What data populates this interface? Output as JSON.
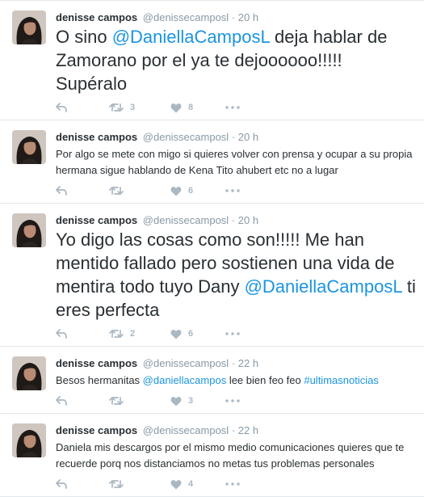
{
  "user": {
    "fullname": "denisse campos",
    "username": "@denissecamposl",
    "separator": "·"
  },
  "tweets": [
    {
      "time": "20 h",
      "size": "big",
      "segments": [
        {
          "t": "O sino ",
          "mention": false
        },
        {
          "t": "@DaniellaCamposL",
          "mention": true
        },
        {
          "t": " deja hablar de Zamorano por el ya te dejoooooo!!!!! Supéralo",
          "mention": false
        }
      ],
      "retweets": "3",
      "likes": "8"
    },
    {
      "time": "20 h",
      "size": "small",
      "segments": [
        {
          "t": "Por algo se mete con migo si quieres volver con prensa y ocupar a su propia hermana sigue hablando de Kena Tito ahubert etc no a lugar",
          "mention": false
        }
      ],
      "retweets": "",
      "likes": "6"
    },
    {
      "time": "20 h",
      "size": "big",
      "segments": [
        {
          "t": "Yo digo las cosas como son!!!!! Me han mentido fallado pero sostienen una vida de mentira todo tuyo Dany ",
          "mention": false
        },
        {
          "t": "@DaniellaCamposL",
          "mention": true
        },
        {
          "t": " ti eres perfecta",
          "mention": false
        }
      ],
      "retweets": "2",
      "likes": "6"
    },
    {
      "time": "22 h",
      "size": "small",
      "segments": [
        {
          "t": "Besos hermanitas ",
          "mention": false
        },
        {
          "t": "@daniellacampos",
          "mention": true
        },
        {
          "t": " lee bien feo feo ",
          "mention": false
        },
        {
          "t": "#ultimasnoticias",
          "mention": true
        }
      ],
      "retweets": "",
      "likes": "3"
    },
    {
      "time": "22 h",
      "size": "small",
      "segments": [
        {
          "t": "Daniela mis descargos por el mismo medio comunicaciones quieres que te recuerde porq nos distanciamos no metas tus problemas personales",
          "mention": false
        }
      ],
      "retweets": "",
      "likes": "4"
    }
  ],
  "icons": {
    "reply": "reply-icon",
    "retweet": "retweet-icon",
    "like": "heart-icon",
    "more": "more-icon"
  },
  "colors": {
    "link": "#1b95e0",
    "meta": "#8899a6",
    "action": "#aab8c2",
    "divider": "#e1e8ed"
  }
}
